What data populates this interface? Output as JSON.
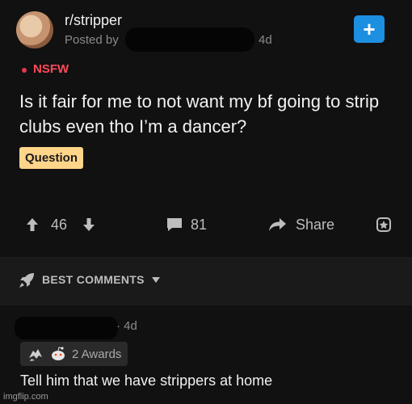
{
  "post": {
    "subreddit": "r/stripper",
    "posted_by": "Posted by",
    "age": "4d",
    "nsfw": "NSFW",
    "title": "Is it fair for me to not want my bf going to strip clubs even tho I’m a dancer?",
    "flair": "Question",
    "votes": "46",
    "comments": "81",
    "share": "Share"
  },
  "best_comments_label": "BEST COMMENTS",
  "comment": {
    "age": "· 4d",
    "awards": "2 Awards",
    "text": "Tell him that we have strippers at home"
  },
  "watermark": "imgflip.com",
  "colors": {
    "join": "#1d8fe0",
    "nsfw": "#ff4b5a",
    "flair": "#ffd58a"
  }
}
